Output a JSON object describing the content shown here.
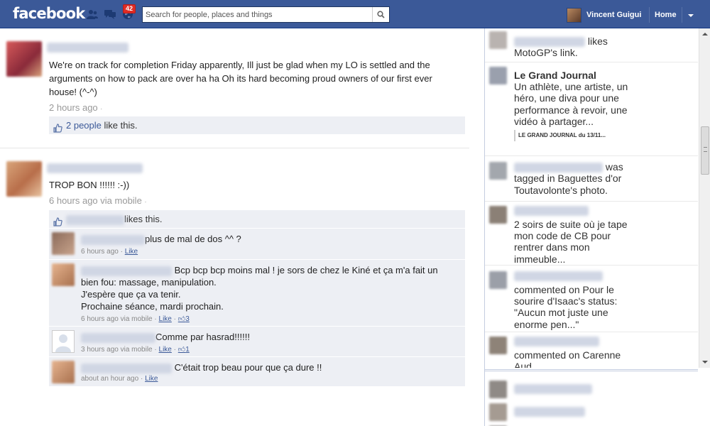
{
  "header": {
    "logo": "facebook",
    "notifications_count": "42",
    "search_placeholder": "Search for people, places and things",
    "user_name": "Vincent Guigui",
    "home_label": "Home"
  },
  "colors": {
    "brand_blue": "#3b5998",
    "link": "#3b5998",
    "badge_red": "#e02c25",
    "panel_gray": "#edeff4"
  },
  "feed": {
    "post1": {
      "text": "We're on track for completion Friday apparently, Ill just be glad when my LO is settled and the arguments on how to pack are over ha ha Oh its hard becoming proud owners of our first ever house! (^-^)",
      "time": "2 hours ago",
      "likes_link": "2 people",
      "likes_suffix": " like this."
    },
    "post2": {
      "text": "TROP BON !!!!!! :-))",
      "time": "6 hours ago via mobile",
      "likes_suffix": "likes this.",
      "comments": [
        {
          "text": "plus de mal de dos ^^ ?",
          "time": "6 hours ago",
          "like": "Like",
          "like_count": ""
        },
        {
          "text": "Bcp bcp bcp moins mal ! je sors de chez le Kiné et ça m'a fait un bien fou: massage, manipulation.\nJ'espère que ça va tenir.\nProchaine séance, mardi prochain.",
          "time": "6 hours ago via mobile",
          "like": "Like",
          "like_count": "3"
        },
        {
          "text": "Comme par hasrad!!!!!!",
          "time": "3 hours ago via mobile",
          "like": "Like",
          "like_count": "1"
        },
        {
          "text": "C'était trop beau pour que ça dure !!",
          "time": "about an hour ago",
          "like": "Like",
          "like_count": ""
        }
      ]
    }
  },
  "ticker": {
    "items": [
      {
        "text": "likes MotoGP's link."
      },
      {
        "title": "Le Grand Journal",
        "text": "Un athlète, une artiste, un héro, une diva pour une performance à revoir, une vidéo à partager...",
        "source": "LE GRAND JOURNAL du 13/11..."
      },
      {
        "text": "was tagged in Baguettes d'or Toutavolonte's photo."
      },
      {
        "text": "2 soirs de suite où je tape mon code de CB pour rentrer dans mon immeuble..."
      },
      {
        "text": "commented on Pour le sourire d'Isaac's status: \"Aucun mot juste une enorme pen...\""
      },
      {
        "text": "commented on Carenne Aud..."
      }
    ]
  }
}
